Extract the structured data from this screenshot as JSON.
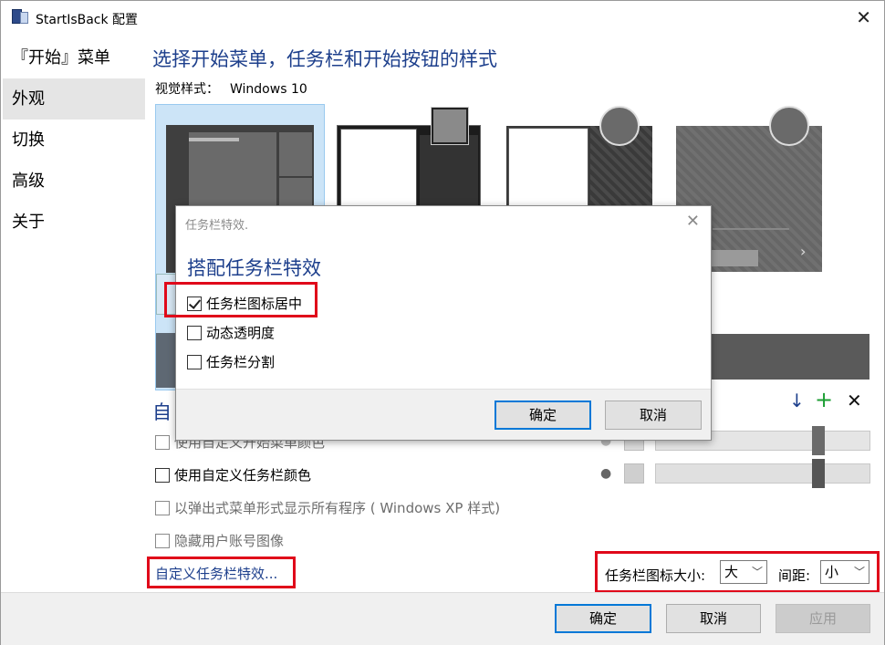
{
  "window": {
    "title": "StartIsBack 配置"
  },
  "sidebar": {
    "items": [
      {
        "label": "『开始』菜单"
      },
      {
        "label": "外观"
      },
      {
        "label": "切换"
      },
      {
        "label": "高级"
      },
      {
        "label": "关于"
      }
    ]
  },
  "main": {
    "heading": "选择开始菜单，任务栏和开始按钮的样式",
    "visual_style_label": "视觉样式：",
    "visual_style_value": "Windows 10",
    "section_heading_partial": "自",
    "options": {
      "custom_start_color": "使用自定义开始菜单颜色",
      "custom_taskbar_color": "使用自定义任务栏颜色",
      "cascading_menu": "以弹出式菜单形式显示所有程序 ( Windows XP 样式)",
      "hide_user_image": "隐藏用户账号图像"
    },
    "custom_taskbar_link": "自定义任务栏特效...",
    "taskbar_icon_size_label": "任务栏图标大小:",
    "taskbar_icon_size_value": "大",
    "spacing_label": "间距:",
    "spacing_value": "小"
  },
  "footer": {
    "ok": "确定",
    "cancel": "取消",
    "apply": "应用"
  },
  "dialog": {
    "title": "任务栏特效.",
    "heading": "搭配任务栏特效",
    "options": [
      {
        "label": "任务栏图标居中",
        "checked": true
      },
      {
        "label": "动态透明度",
        "checked": false
      },
      {
        "label": "任务栏分割",
        "checked": false
      }
    ],
    "ok": "确定",
    "cancel": "取消"
  },
  "colors": {
    "accent_blue": "#1d3f8c",
    "highlight_red": "#e0091a",
    "add_green": "#1c9e33"
  }
}
